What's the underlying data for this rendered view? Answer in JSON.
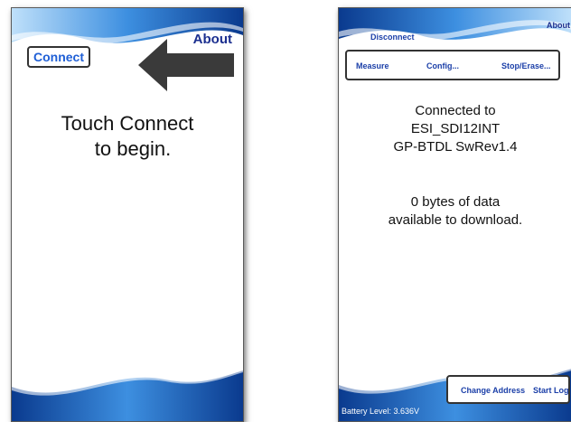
{
  "left_screen": {
    "connect_label": "Connect",
    "about_label": "About",
    "message_line1": "Touch Connect",
    "message_line2": "to begin."
  },
  "right_screen": {
    "disconnect_label": "Disconnect",
    "about_label": "About",
    "menu": [
      {
        "label": "Measure"
      },
      {
        "label": "Config..."
      },
      {
        "label": "Stop/Erase..."
      }
    ],
    "status_line1": "Connected to",
    "status_line2": "ESI_SDI12INT",
    "status_line3": "GP-BTDL SwRev1.4",
    "data_line1": "0 bytes of data",
    "data_line2": "available to download.",
    "bottom_buttons": [
      {
        "label": "Change Address"
      },
      {
        "label": "Start Log"
      }
    ],
    "battery_text": "Battery Level: 3.636V"
  },
  "colors": {
    "link_blue": "#1f5fd6",
    "wave_dark": "#0b3f94",
    "wave_light": "#4fa3e6"
  },
  "icons": [
    "arrow-left-icon"
  ]
}
